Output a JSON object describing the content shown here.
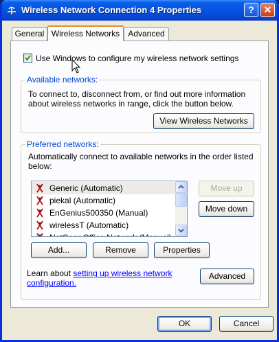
{
  "window": {
    "title": "Wireless Network Connection 4 Properties",
    "help_label": "?",
    "close_label": "✕"
  },
  "tabs": [
    {
      "label": "General",
      "active": false
    },
    {
      "label": "Wireless Networks",
      "active": true
    },
    {
      "label": "Advanced",
      "active": false
    }
  ],
  "config_checkbox": {
    "label": "Use Windows to configure my wireless network settings",
    "checked": true
  },
  "available": {
    "title": "Available networks:",
    "description_line1": "To connect to, disconnect from, or find out more information",
    "description_line2": "about wireless networks in range, click the button below.",
    "view_button": "View Wireless Networks"
  },
  "preferred": {
    "title": "Preferred networks:",
    "description_line1": "Automatically connect to available networks in the order listed",
    "description_line2": "below:",
    "networks": [
      {
        "label": "Generic (Automatic)",
        "selected": true
      },
      {
        "label": "piekal (Automatic)",
        "selected": false
      },
      {
        "label": "EnGenius500350 (Manual)",
        "selected": false
      },
      {
        "label": "wirelessT (Automatic)",
        "selected": false
      },
      {
        "label": "NetGear Office Network (Manual)",
        "selected": false
      }
    ],
    "move_up": "Move up",
    "move_down": "Move down",
    "add": "Add...",
    "remove": "Remove",
    "properties": "Properties"
  },
  "learn": {
    "prefix": "Learn about ",
    "link_line1": "setting up wireless network",
    "link_line2": "configuration.",
    "advanced_button": "Advanced"
  },
  "footer": {
    "ok": "OK",
    "cancel": "Cancel"
  }
}
